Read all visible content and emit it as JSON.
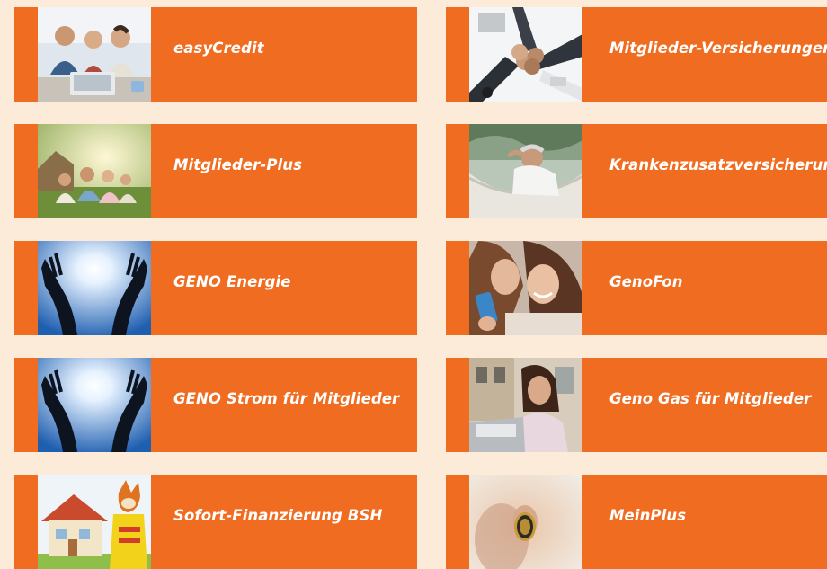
{
  "tiles": [
    {
      "label": "easyCredit",
      "image": "family-laptop-photo"
    },
    {
      "label": "Mitglieder-Versicherungen",
      "image": "fist-bump-photo"
    },
    {
      "label": "Mitglieder-Plus",
      "image": "family-lawn-photo"
    },
    {
      "label": "Krankenzusatzversicherung",
      "image": "man-hammock-photo"
    },
    {
      "label": "GENO Energie",
      "image": "hands-sun-photo"
    },
    {
      "label": "GenoFon",
      "image": "girls-phone-photo"
    },
    {
      "label": "GENO Strom für Mitglieder",
      "image": "hands-sun-photo"
    },
    {
      "label": "Geno Gas für Mitglieder",
      "image": "girl-laptop-photo"
    },
    {
      "label": "Sofort-Finanzierung BSH",
      "image": "house-fox-photo"
    },
    {
      "label": "MeinPlus",
      "image": "coin-hand-photo"
    }
  ],
  "colors": {
    "tile": "#f06c20",
    "background": "#fdebd9",
    "text": "#ffffff"
  }
}
